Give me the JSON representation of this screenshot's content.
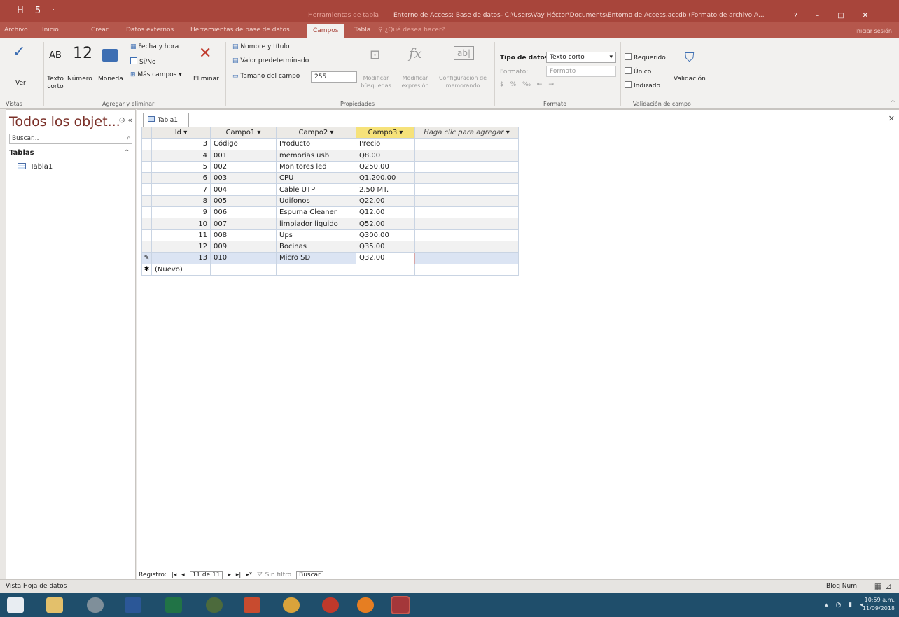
{
  "titlebar": {
    "qat": "H 5 ·",
    "context_title": "Herramientas de tabla",
    "title": "Entorno de Access: Base de datos- C:\\Users\\Vay Héctor\\Documents\\Entorno de Access.accdb (Formato de archivo A...",
    "help": "?",
    "minimize": "–",
    "maximize": "□",
    "close": "✕"
  },
  "tabs": [
    "Archivo",
    "Inicio",
    "Crear",
    "Datos externos",
    "Herramientas de base de datos",
    "Campos",
    "Tabla"
  ],
  "active_tab": "Campos",
  "tell_me": "¿Qué desea hacer?",
  "user": "Iniciar sesión",
  "ribbon": {
    "vistas": {
      "ver_label": "Ver",
      "group": "Vistas"
    },
    "agregar": {
      "texto_corto": "Texto corto",
      "numero": "Número",
      "moneda": "Moneda",
      "fecha_hora": "Fecha y hora",
      "si_no": "Sí/No",
      "mas_campos": "Más campos",
      "eliminar": "Eliminar",
      "group": "Agregar y eliminar"
    },
    "propiedades": {
      "nombre_titulo": "Nombre y título",
      "valor_predeterminado": "Valor predeterminado",
      "tamano_campo": "Tamaño del campo",
      "tamano_value": "255",
      "modificar_busquedas": "Modificar búsquedas",
      "modificar_expresion": "Modificar expresión",
      "configuracion_memorando": "Configuración de memorando",
      "group": "Propiedades"
    },
    "formato": {
      "tipo_datos_label": "Tipo de datos:",
      "tipo_datos_value": "Texto corto",
      "formato_label": "Formato:",
      "formato_value": "Formato",
      "group": "Formato"
    },
    "validacion": {
      "requerido": "Requerido",
      "unico": "Único",
      "indizado": "Indizado",
      "validacion": "Validación",
      "group": "Validación de campo"
    }
  },
  "nav": {
    "title": "Todos los objet...",
    "search_placeholder": "Buscar...",
    "group": "Tablas",
    "items": [
      "Tabla1"
    ]
  },
  "doc": {
    "tab": "Tabla1",
    "columns": [
      "Id",
      "Campo1",
      "Campo2",
      "Campo3",
      "Haga clic para agregar"
    ],
    "rows": [
      [
        "3",
        "Código",
        "Producto",
        "Precio"
      ],
      [
        "4",
        "001",
        "memorias usb",
        "Q8.00"
      ],
      [
        "5",
        "002",
        "Monitores led",
        "Q250.00"
      ],
      [
        "6",
        "003",
        "CPU",
        "Q1,200.00"
      ],
      [
        "7",
        "004",
        "Cable UTP",
        "2.50 MT."
      ],
      [
        "8",
        "005",
        "Udifonos",
        "Q22.00"
      ],
      [
        "9",
        "006",
        "Espuma Cleaner",
        "Q12.00"
      ],
      [
        "10",
        "007",
        "limpiador liquido",
        "Q52.00"
      ],
      [
        "11",
        "008",
        "Ups",
        "Q300.00"
      ],
      [
        "12",
        "009",
        "Bocinas",
        "Q35.00"
      ],
      [
        "13",
        "010",
        "Micro SD",
        "Q32.00"
      ]
    ],
    "new_row": "(Nuevo)"
  },
  "recnav": {
    "label": "Registro:",
    "position": "11 de 11",
    "filter": "Sin filtro",
    "search": "Buscar"
  },
  "status": {
    "left": "Vista Hoja de datos",
    "right": "Bloq Num"
  },
  "clock": {
    "time": "10:59 a.m.",
    "date": "11/09/2018"
  }
}
